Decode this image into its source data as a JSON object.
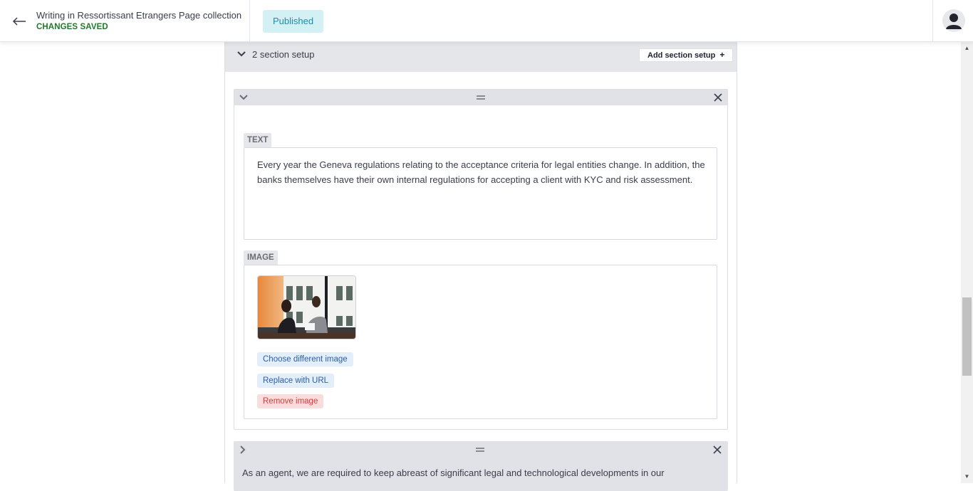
{
  "header": {
    "back_icon": "arrow-left-icon",
    "doc_title": "Writing in Ressortissant Etrangers Page collection",
    "save_status": "CHANGES SAVED",
    "status_badge": "Published",
    "avatar_icon": "user-avatar-icon"
  },
  "section": {
    "title": "2 section setup",
    "add_button": "Add section setup",
    "add_icon": "+"
  },
  "block1": {
    "text_label": "TEXT",
    "text_value": "Every year the Geneva regulations relating to the acceptance criteria for legal entities change. In addition, the banks themselves have their own internal regulations for accepting a client with KYC and risk assessment.",
    "image_label": "IMAGE",
    "choose_image": "Choose different image",
    "replace_url": "Replace with URL",
    "remove_image": "Remove image"
  },
  "block2": {
    "preview_text": "As an agent, we are required to keep abreast of significant legal and technological developments in our"
  },
  "colors": {
    "accent_green": "#207a2a",
    "badge_bg": "#d3f1f5",
    "badge_text": "#1b8ea3",
    "link_blue": "#2c5da8",
    "danger_red": "#d43a3a"
  }
}
